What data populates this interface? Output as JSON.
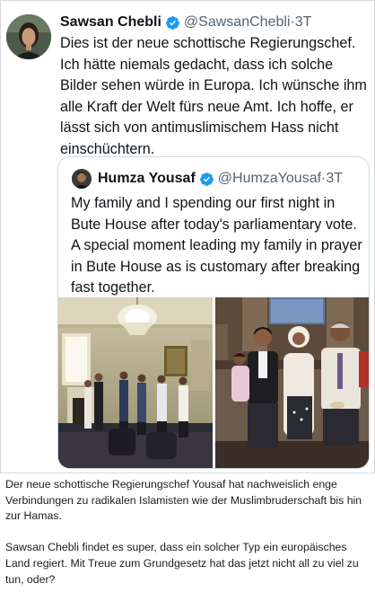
{
  "tweet": {
    "author_name": "Sawsan Chebli",
    "author_handle": "@SawsanChebli",
    "separator": "·",
    "time": "3T",
    "text": "Dies ist der neue schottische Regierungschef. Ich hätte niemals gedacht, dass ich solche Bilder sehen würde in Europa. Ich wünsche ihm alle Kraft der Welt fürs neue Amt. Ich hoffe, er lässt sich von antimuslimischem Hass nicht einschüchtern.",
    "verified_icon": "verified-badge-icon",
    "accent_color": "#1d9bf0"
  },
  "quoted_tweet": {
    "author_name": "Humza Yousaf",
    "author_handle": "@HumzaYousaf",
    "separator": "·",
    "time": "3T",
    "text": "My family and I spending our first night in Bute House after today's parliamentary vote. A special moment leading my family in prayer in Bute House as is customary after breaking fast together.",
    "verified_icon": "verified-badge-icon"
  },
  "comment": {
    "paragraph_1": "Der neue schottische Regierungschef Yousaf hat nachweislich enge Verbindungen zu radikalen Islamisten wie der Muslimbruderschaft bis hin zur Hamas.",
    "paragraph_2": "Sawsan Chebli findet es super, dass ein solcher Typ ein europäisches Land regiert. Mit Treue zum Grundgesetz hat das jetzt nicht all zu viel zu tun, oder?"
  }
}
